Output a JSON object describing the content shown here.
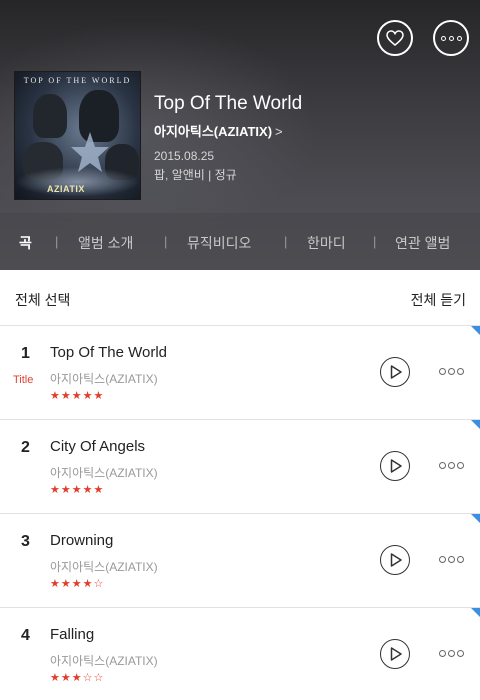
{
  "header": {
    "cover_title": "TOP OF THE WORLD",
    "cover_logo": "AZIATIX",
    "album_title": "Top Of The World",
    "artist": "아지아틱스(AZIATIX)",
    "artist_chevron": ">",
    "release_date": "2015.08.25",
    "genre_type": "팝, 알앤비 | 정규",
    "like_icon": "heart-icon",
    "more_icon": "more-dots-icon"
  },
  "tabs": [
    {
      "label": "곡",
      "active": true
    },
    {
      "label": "앨범 소개",
      "active": false
    },
    {
      "label": "뮤직비디오",
      "active": false
    },
    {
      "label": "한마디",
      "active": false
    },
    {
      "label": "연관 앨범",
      "active": false
    }
  ],
  "list_header": {
    "select_all": "전체 선택",
    "play_all": "전체 듣기"
  },
  "tracks": [
    {
      "number": "1",
      "tag": "Title",
      "title": "Top Of The World",
      "artist": "아지아틱스(AZIATIX)",
      "rating": 5,
      "rating_max": 5
    },
    {
      "number": "2",
      "tag": "",
      "title": "City Of Angels",
      "artist": "아지아틱스(AZIATIX)",
      "rating": 5,
      "rating_max": 5
    },
    {
      "number": "3",
      "tag": "",
      "title": "Drowning",
      "artist": "아지아틱스(AZIATIX)",
      "rating": 4,
      "rating_max": 5
    },
    {
      "number": "4",
      "tag": "",
      "title": "Falling",
      "artist": "아지아틱스(AZIATIX)",
      "rating": 3,
      "rating_max": 5
    }
  ],
  "colors": {
    "accent_red": "#e43c2a",
    "corner_blue": "#3b8fe0"
  }
}
